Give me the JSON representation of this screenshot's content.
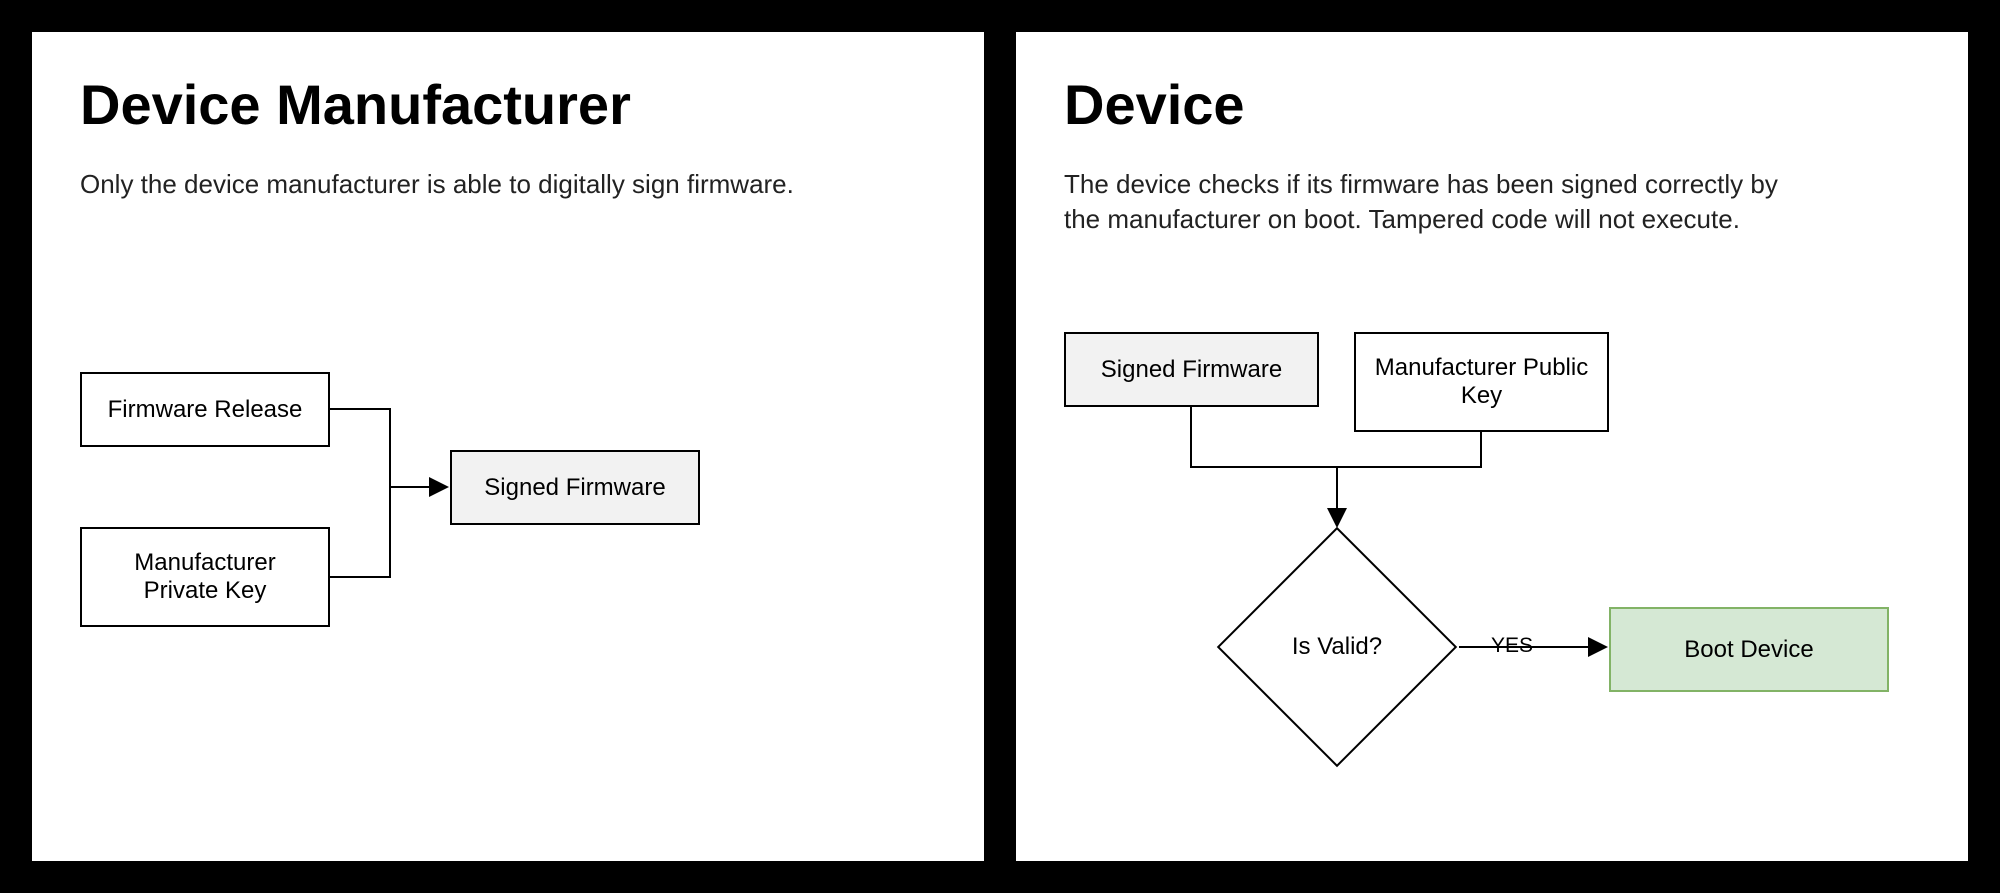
{
  "left": {
    "title": "Device Manufacturer",
    "description": "Only the device manufacturer is able to digitally sign firmware.",
    "boxes": {
      "firmware_release": "Firmware Release",
      "private_key": "Manufacturer Private Key",
      "signed_firmware": "Signed Firmware"
    }
  },
  "right": {
    "title": "Device",
    "description": "The device checks if its firmware has been signed correctly by the manufacturer on boot. Tampered code will not execute.",
    "boxes": {
      "signed_firmware": "Signed Firmware",
      "public_key": "Manufacturer Public Key",
      "is_valid": "Is Valid?",
      "yes": "YES",
      "boot_device": "Boot Device"
    }
  }
}
